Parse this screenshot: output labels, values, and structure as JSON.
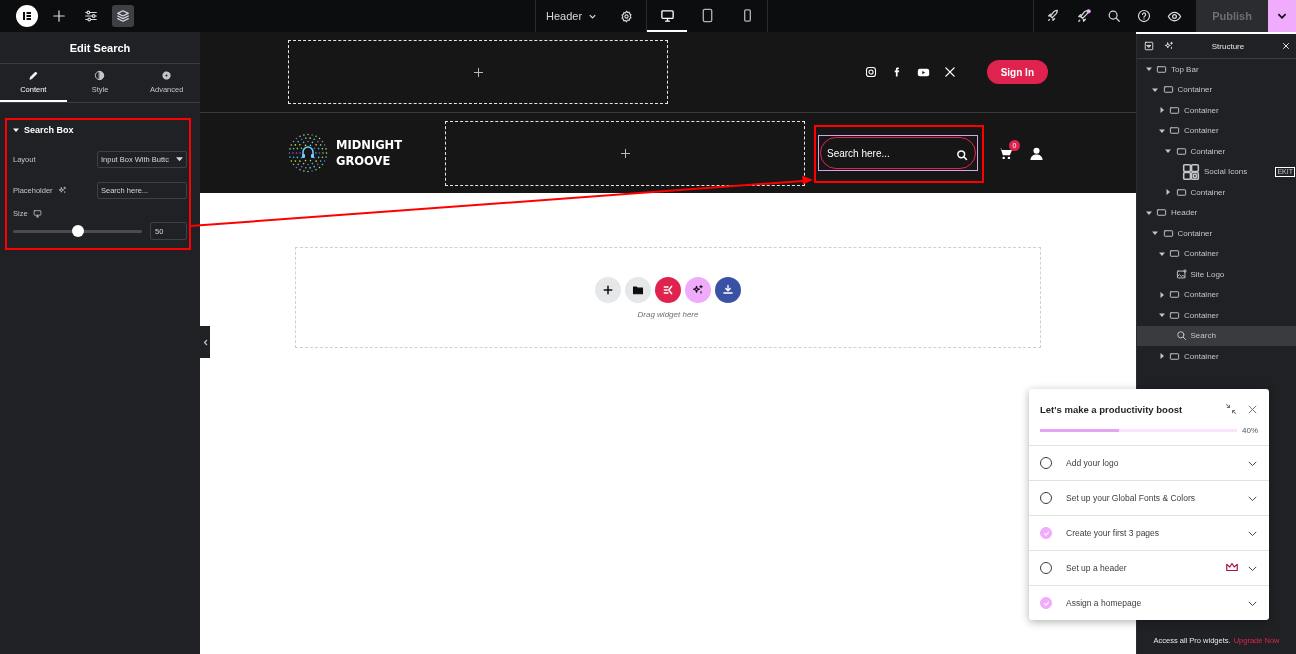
{
  "topbar": {
    "tools": [
      {
        "kind": "add",
        "selected": false
      },
      {
        "kind": "settings",
        "selected": false
      },
      {
        "kind": "layers",
        "selected": true
      }
    ],
    "document": "Header",
    "devices": [
      {
        "kind": "desktop",
        "selected": true
      },
      {
        "kind": "tablet",
        "selected": false
      },
      {
        "kind": "mobile",
        "selected": false
      }
    ],
    "actions": [
      {
        "kind": "rocket"
      },
      {
        "kind": "announcements"
      },
      {
        "kind": "search"
      },
      {
        "kind": "help"
      },
      {
        "kind": "preview"
      }
    ],
    "publish": {
      "label": "Publish",
      "disabled": true
    }
  },
  "panel": {
    "title": "Edit Search",
    "tabs": [
      {
        "label": "Content",
        "kind": "pencil",
        "selected": true
      },
      {
        "label": "Style",
        "kind": "contrast",
        "selected": false
      },
      {
        "label": "Advanced",
        "kind": "gear",
        "selected": false
      }
    ],
    "section": {
      "title": "Search Box",
      "expanded": true,
      "controls": [
        {
          "kind": "select",
          "label": "Layout",
          "value": "Input Box With Buttc"
        },
        {
          "kind": "text",
          "label": "Placeholder",
          "value": "Search here..."
        },
        {
          "kind": "slider",
          "label": "Size",
          "level": 0.5,
          "value": "50"
        }
      ]
    }
  },
  "canvas": {
    "top_bar": {
      "social": [
        {
          "kind": "instagram"
        },
        {
          "kind": "facebook"
        },
        {
          "kind": "youtube"
        },
        {
          "kind": "x"
        }
      ],
      "button": "Sign In"
    },
    "header": {
      "logo": "MIDNIGHT GROOVE",
      "search": {
        "placeholder": "Search here..."
      },
      "cart_count": "0"
    },
    "drop_zone": {
      "actions": [
        {
          "kind": "add"
        },
        {
          "kind": "template"
        },
        {
          "kind": "kit"
        },
        {
          "kind": "ai"
        },
        {
          "kind": "import"
        }
      ],
      "hint": "Drag widget here"
    }
  },
  "structure": {
    "title": "Structure",
    "tree": [
      {
        "label": "Top Bar",
        "kind": "container",
        "expanded": true,
        "selected": false,
        "children": [
          {
            "label": "Container",
            "kind": "container",
            "expanded": true,
            "selected": false,
            "children": [
              {
                "label": "Container",
                "kind": "container",
                "expanded": false,
                "selected": false
              },
              {
                "label": "Container",
                "kind": "container",
                "expanded": true,
                "selected": false,
                "children": [
                  {
                    "label": "Container",
                    "kind": "container",
                    "expanded": true,
                    "selected": false,
                    "children": [
                      {
                        "label": "Social Icons",
                        "kind": "social",
                        "selected": false,
                        "badge": "EKIT"
                      }
                    ]
                  },
                  {
                    "label": "Container",
                    "kind": "container",
                    "expanded": false,
                    "selected": false
                  }
                ]
              }
            ]
          }
        ]
      },
      {
        "label": "Header",
        "kind": "container",
        "expanded": true,
        "selected": false,
        "children": [
          {
            "label": "Container",
            "kind": "container",
            "expanded": true,
            "selected": false,
            "children": [
              {
                "label": "Container",
                "kind": "container",
                "expanded": true,
                "selected": false,
                "children": [
                  {
                    "label": "Site Logo",
                    "kind": "logo",
                    "selected": false
                  }
                ]
              },
              {
                "label": "Container",
                "kind": "container",
                "expanded": false,
                "selected": false
              },
              {
                "label": "Container",
                "kind": "container",
                "expanded": true,
                "selected": false,
                "children": [
                  {
                    "label": "Search",
                    "kind": "search",
                    "selected": true
                  }
                ]
              },
              {
                "label": "Container",
                "kind": "container",
                "expanded": false,
                "selected": false
              }
            ]
          }
        ]
      }
    ]
  },
  "promo": {
    "text": "Access all Pro widgets.",
    "link": "Upgrade Now"
  },
  "checklist": {
    "title": "Let's make a productivity boost",
    "level": 0.4,
    "percent": "40%",
    "items": [
      {
        "label": "Add your logo",
        "checked": false,
        "pro": false
      },
      {
        "label": "Set up your Global Fonts & Colors",
        "checked": false,
        "pro": false
      },
      {
        "label": "Create your first 3 pages",
        "checked": true,
        "pro": false
      },
      {
        "label": "Set up a header",
        "checked": false,
        "pro": true
      },
      {
        "label": "Assign a homepage",
        "checked": true,
        "pro": false
      }
    ]
  }
}
